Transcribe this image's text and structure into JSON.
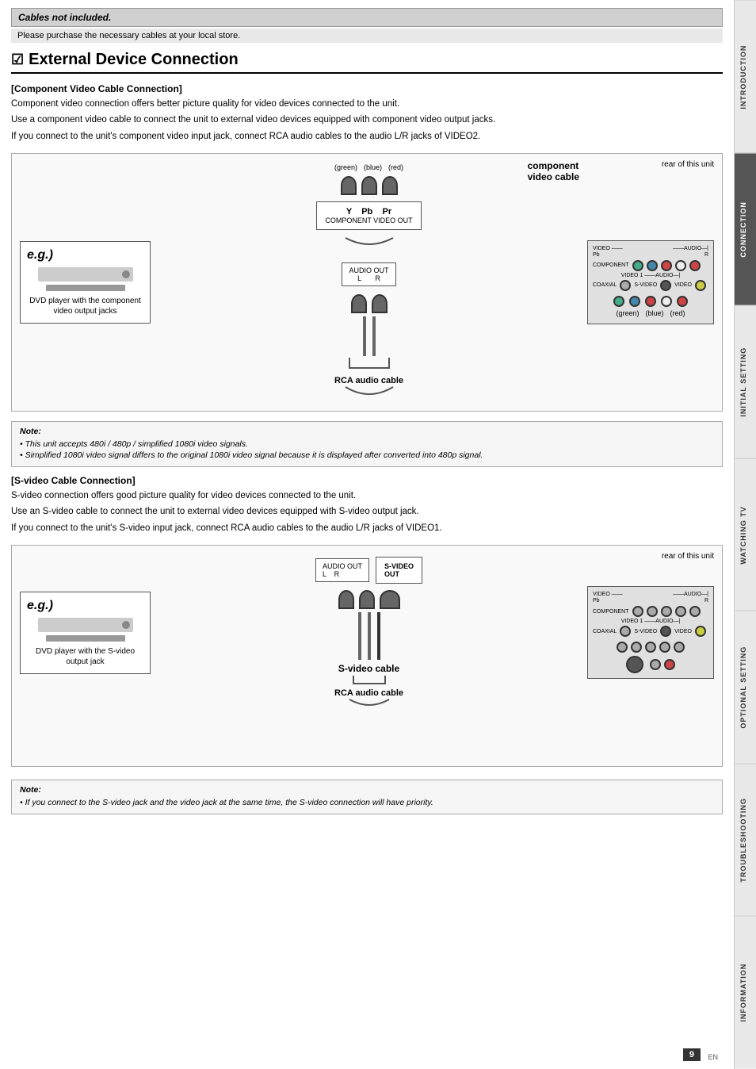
{
  "cables_note": {
    "bold": "Cables not included.",
    "sub": "Please purchase the necessary cables at your local store."
  },
  "section": {
    "title": "External Device Connection",
    "checkbox": "☑"
  },
  "component_section": {
    "subtitle": "[Component Video Cable Connection]",
    "para1": "Component video connection offers better picture quality for video devices connected to the unit.",
    "para2": "Use a component video cable to connect the unit to external video devices equipped with component video output jacks.",
    "para3": "If you connect to the unit's component video input jack, connect RCA audio cables to the audio L/R jacks of VIDEO2.",
    "dvd_label": "DVD player with the component\nvideo output jacks",
    "video_cable_label": "component\nvideo cable",
    "rear_label": "rear of this unit",
    "rca_label": "RCA audio cable",
    "color_green": "(green)",
    "color_blue": "(blue)",
    "color_red": "(red)",
    "eg": "e.g.)",
    "component_out": "Y    Pb    Pr",
    "component_out_sub": "COMPONENT VIDEO OUT",
    "audio_out": "AUDIO OUT",
    "audio_lr": "L         R"
  },
  "note1": {
    "title": "Note:",
    "lines": [
      "• This unit accepts 480i / 480p / simplified 1080i video signals.",
      "• Simplified 1080i video signal differs to the original 1080i video signal because it is displayed after converted into 480p signal."
    ]
  },
  "svideo_section": {
    "subtitle": "[S-video Cable Connection]",
    "para1": "S-video connection offers good picture quality for video devices connected to the unit.",
    "para2": "Use an S-video cable to connect the unit to external video devices equipped with S-video output jack.",
    "para3": "If you connect to the unit's S-video input jack, connect RCA audio cables to the audio L/R jacks of VIDEO1.",
    "dvd_label": "DVD player with the S-video\noutput jack",
    "rear_label": "rear of this unit",
    "svideo_label": "S-video cable",
    "rca_label": "RCA audio cable",
    "eg": "e.g.)",
    "audio_out": "AUDIO OUT",
    "audio_lr": "L    R",
    "svideo_out": "S-VIDEO\nOUT"
  },
  "note2": {
    "title": "Note:",
    "lines": [
      "• If you connect to the S-video jack and the video jack at the same time, the S-video connection will have priority."
    ]
  },
  "page_number": "9",
  "tabs": [
    {
      "label": "INTRODUCTION",
      "active": false
    },
    {
      "label": "CONNECTION",
      "active": true
    },
    {
      "label": "INITIAL SETTING",
      "active": false
    },
    {
      "label": "WATCHING TV",
      "active": false
    },
    {
      "label": "OPTIONAL SETTING",
      "active": false
    },
    {
      "label": "TROUBLESHOOTING",
      "active": false
    },
    {
      "label": "INFORMATION",
      "active": false
    }
  ]
}
